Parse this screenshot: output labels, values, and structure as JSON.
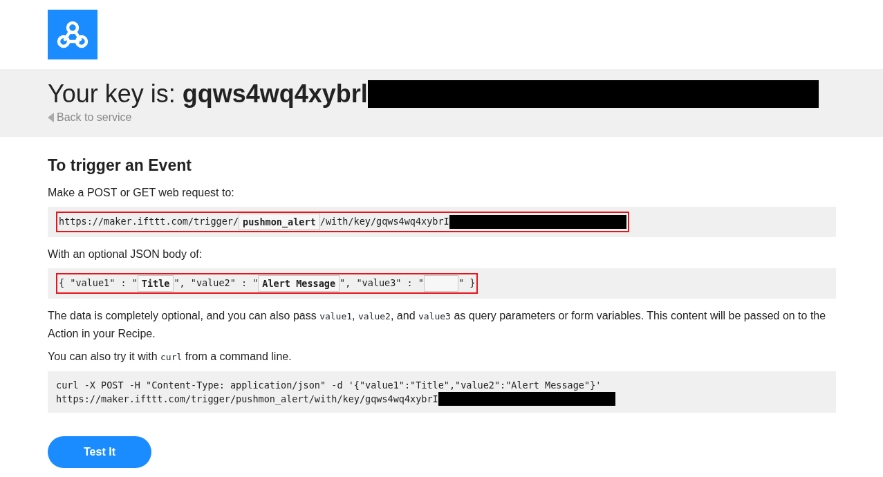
{
  "header": {
    "prefix": "Your key is:",
    "key": "gqws4wq4xybrl",
    "key_redacted": true,
    "back_link": "Back to service"
  },
  "heading": "To trigger an Event",
  "intro": "Make a POST or GET web request to:",
  "url_line": {
    "highlighted": true,
    "parts": [
      {
        "kind": "text",
        "text": "https://maker.ifttt.com/trigger/"
      },
      {
        "kind": "field",
        "text": "pushmon_alert"
      },
      {
        "kind": "text",
        "text": "/with/key/gqws4wq4xybrI"
      },
      {
        "kind": "redacted"
      }
    ]
  },
  "body_intro": "With an optional JSON body of:",
  "body_line": {
    "highlighted": true,
    "parts": [
      {
        "kind": "text",
        "text": "{ \"value1\" : \""
      },
      {
        "kind": "field",
        "text": "Title"
      },
      {
        "kind": "text",
        "text": "\", \"value2\" : \""
      },
      {
        "kind": "field",
        "text": "Alert Message"
      },
      {
        "kind": "text",
        "text": "\", \"value3\" : \""
      },
      {
        "kind": "field"
      },
      {
        "kind": "text",
        "text": "\" }"
      }
    ]
  },
  "note": [
    {
      "kind": "text",
      "text": "The data is completely optional, and you can also pass "
    },
    {
      "kind": "code",
      "text": "value1"
    },
    {
      "kind": "text",
      "text": ", "
    },
    {
      "kind": "code",
      "text": "value2"
    },
    {
      "kind": "text",
      "text": ", and "
    },
    {
      "kind": "code",
      "text": "value3"
    },
    {
      "kind": "text",
      "text": " as query parameters or form variables. This content will be passed on to the Action in your Recipe."
    }
  ],
  "curl_note": [
    {
      "kind": "text",
      "text": "You can also try it with "
    },
    {
      "kind": "code",
      "text": "curl"
    },
    {
      "kind": "text",
      "text": " from a command line."
    }
  ],
  "curl_lines": [
    {
      "text": "curl -X POST -H \"Content-Type: application/json\" -d '{\"value1\":\"Title\",\"value2\":\"Alert Message\"}'",
      "redacted": false
    },
    {
      "text": "https://maker.ifttt.com/trigger/pushmon_alert/with/key/gqws4wq4xybrI",
      "redacted": true
    }
  ],
  "button": "Test It"
}
